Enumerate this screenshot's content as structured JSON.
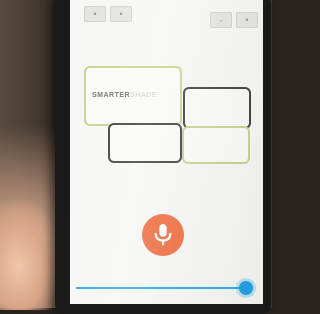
{
  "app": {
    "logo": {
      "bold": "SMARTER",
      "light": "SHADE"
    }
  },
  "top_controls": {
    "left_a": "•",
    "left_b": "•",
    "right_a": "–",
    "right_b": "•"
  },
  "microphone": {
    "icon": "microphone-icon",
    "color": "#ef6a3c"
  },
  "level_slider": {
    "value_fraction": 0.97,
    "color": "#1e9fe4"
  },
  "colors": {
    "panel_green": "#c9d28c",
    "panel_dark": "#3c3c3c",
    "screen_bg": "#f6f6f4"
  }
}
